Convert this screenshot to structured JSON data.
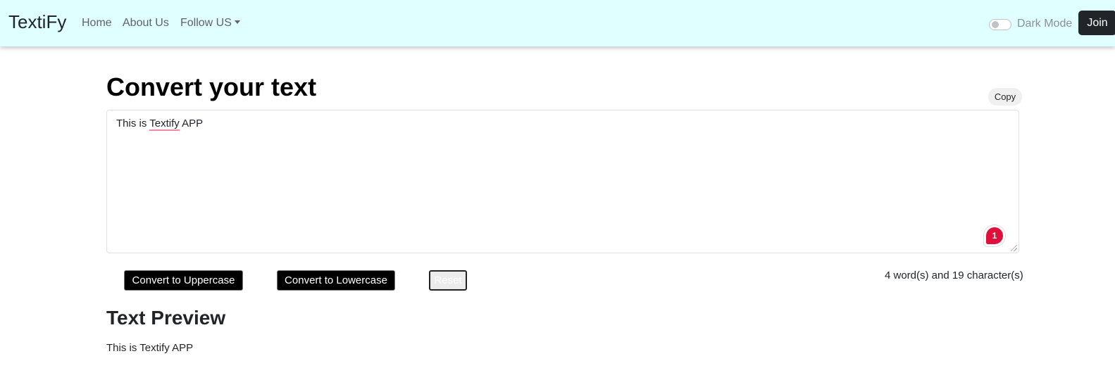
{
  "navbar": {
    "brand": "TextiFy",
    "links": [
      "Home",
      "About Us",
      "Follow US"
    ],
    "dark_mode_label": "Dark Mode",
    "dark_mode_enabled": false,
    "join_label": "Join",
    "background_color": "#e0ffff"
  },
  "main": {
    "title": "Convert your text",
    "copy_label": "Copy",
    "textarea_value": "This is Textify APP",
    "textarea_parts": {
      "before": "This is ",
      "misspelled": "Textify",
      "after": " APP"
    },
    "grammar_badge_count": "1",
    "buttons": {
      "uppercase": "Convert to Uppercase",
      "lowercase": "Convert to Lowercase",
      "reset": "Reset"
    },
    "counts": "4 word(s) and 19 character(s)",
    "preview_title": "Text Preview",
    "preview_text": "This is Textify APP"
  },
  "colors": {
    "button_bg": "#000000",
    "join_bg": "#212529",
    "grammar_badge": "#e0103a"
  }
}
